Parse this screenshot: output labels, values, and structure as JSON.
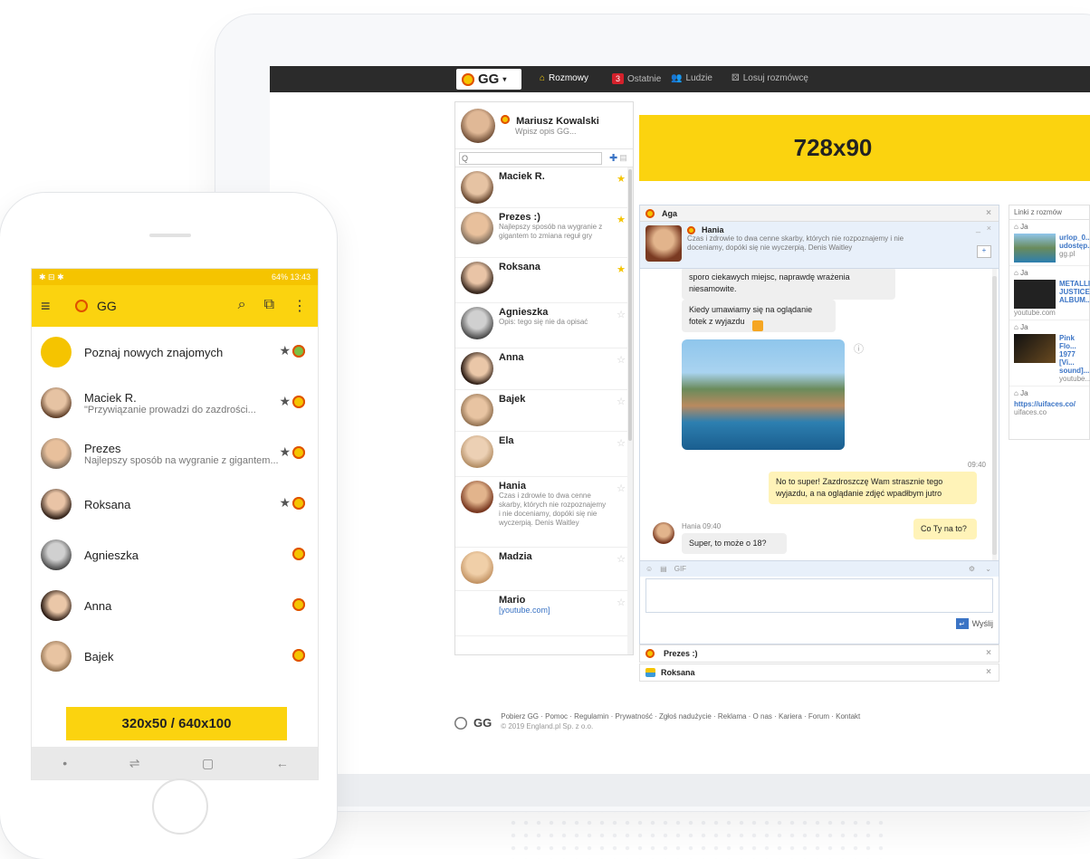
{
  "web": {
    "topbar": {
      "logo": "GG",
      "nav": [
        {
          "label": "Rozmowy"
        },
        {
          "badge": "3",
          "label": "Ostatnie"
        },
        {
          "label": "Ludzie"
        },
        {
          "label": "Losuj rozmówcę"
        }
      ]
    },
    "me": {
      "name": "Mariusz Kowalski",
      "desc": "Wpisz opis GG..."
    },
    "search": {
      "placeholder": "Q"
    },
    "contacts": [
      {
        "name": "Maciek R.",
        "desc": "",
        "star": "★"
      },
      {
        "name": "Prezes :)",
        "desc": "Najlepszy sposób na wygranie z gigantem to zmiana reguł gry",
        "star": "★"
      },
      {
        "name": "Roksana",
        "desc": "",
        "star": "★"
      },
      {
        "name": "Agnieszka",
        "desc": "Opis: tego się nie da opisać",
        "star": "☆"
      },
      {
        "name": "Anna",
        "desc": "",
        "star": "☆"
      },
      {
        "name": "Bajek",
        "desc": "",
        "star": "☆"
      },
      {
        "name": "Ela",
        "desc": "",
        "star": "☆"
      },
      {
        "name": "Hania",
        "desc": "Czas i zdrowie to dwa cenne skarby, których nie rozpoznajemy i nie doceniamy, dopóki się nie wyczerpią. Denis Waitley",
        "star": "☆"
      },
      {
        "name": "Madzia",
        "desc": "",
        "star": "☆"
      },
      {
        "name": "Mario",
        "link": "[youtube.com]",
        "star": "☆"
      }
    ],
    "ad_top": "728x90",
    "chat": {
      "tab": "Aga",
      "partner_name": "Hania",
      "partner_desc": "Czas i zdrowie to dwa cenne skarby, których nie rozpoznajemy i nie doceniamy, dopóki się nie wyczerpią. Denis Waitley",
      "messages": {
        "m1": "sporo ciekawych miejsc, naprawdę wrażenia niesamowite.",
        "m2": "Kiedy umawiamy się na oglądanie fotek z wyjazdu",
        "time1": "09:40",
        "m3": "No to super! Zazdroszczę Wam strasznie tego wyjazdu, a na oglądanie zdjęć wpadłbym jutro",
        "m4": "Co Ty na to?",
        "sender": "Hania 09:40",
        "m5": "Super, to może o 18?"
      },
      "gif": "GIF",
      "send": "Wyślij"
    },
    "mini_chats": [
      "Prezes :)",
      "Roksana"
    ],
    "links_panel": {
      "title": "Linki z rozmów",
      "items": [
        {
          "who": "Ja",
          "text": "urlop_0... udostęp...",
          "domain": "gg.pl"
        },
        {
          "who": "Ja",
          "text": "METALLI... JUSTICE... ALBUM...",
          "domain": "youtube.com"
        },
        {
          "who": "Ja",
          "text": "Pink Flo... 1977 [Vi... sound]...",
          "domain": "youtube..."
        },
        {
          "who": "Ja",
          "text": "https://uifaces.co/",
          "domain": "uifaces.co"
        }
      ]
    },
    "footer": {
      "logo": "GG",
      "links": "Pobierz GG · Pomoc · Regulamin · Prywatność · Zgłoś nadużycie · Reklama · O nas · Kariera · Forum · Kontakt",
      "copyright": "© 2019 England.pl Sp. z o.o."
    }
  },
  "phone": {
    "status": {
      "left": "✱ ⊟ ✱",
      "right": "64% 13:43"
    },
    "app_title": "GG",
    "items": [
      {
        "name": "Poznaj nowych znajomych",
        "desc": "",
        "star": "★"
      },
      {
        "name": "Maciek R.",
        "desc": "\"Przywiązanie prowadzi do zazdrości...",
        "star": "★"
      },
      {
        "name": "Prezes",
        "desc": "Najlepszy sposób na wygranie z gigantem...",
        "star": "★"
      },
      {
        "name": "Roksana",
        "desc": "",
        "star": "★"
      },
      {
        "name": "Agnieszka",
        "desc": "",
        "star": ""
      },
      {
        "name": "Anna",
        "desc": "",
        "star": ""
      },
      {
        "name": "Bajek",
        "desc": "",
        "star": ""
      }
    ],
    "ad": "320x50 / 640x100"
  },
  "colors": {
    "brand_yellow": "#fbd30f",
    "topbar": "#2b2b2b",
    "link": "#3b74c5",
    "badge": "#d4212b"
  }
}
